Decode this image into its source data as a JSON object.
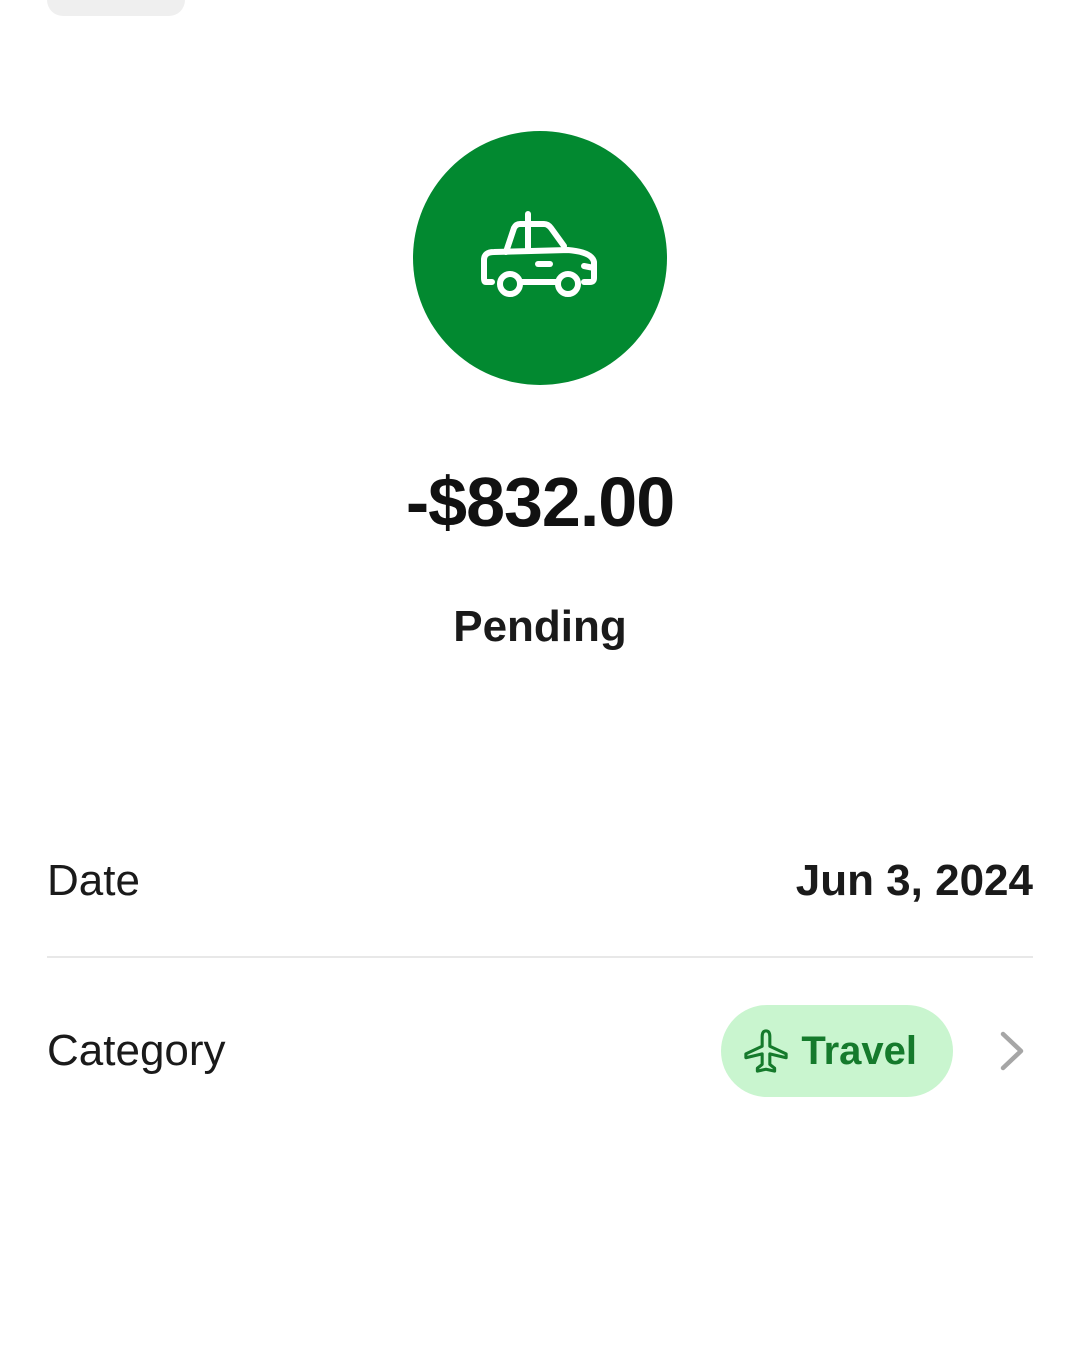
{
  "theme": {
    "brand_green": "#028930",
    "pill_background": "#c9f5cf",
    "pill_text": "#157a2c",
    "chevron_color": "#a6a6a6"
  },
  "merchant": {
    "icon": "taxi-icon"
  },
  "transaction": {
    "amount": "-$832.00",
    "status": "Pending"
  },
  "details": {
    "date_label": "Date",
    "date_value": "Jun 3, 2024",
    "category_label": "Category",
    "category_value": "Travel",
    "category_icon": "airplane-icon",
    "category_action_icon": "chevron-right-icon"
  }
}
